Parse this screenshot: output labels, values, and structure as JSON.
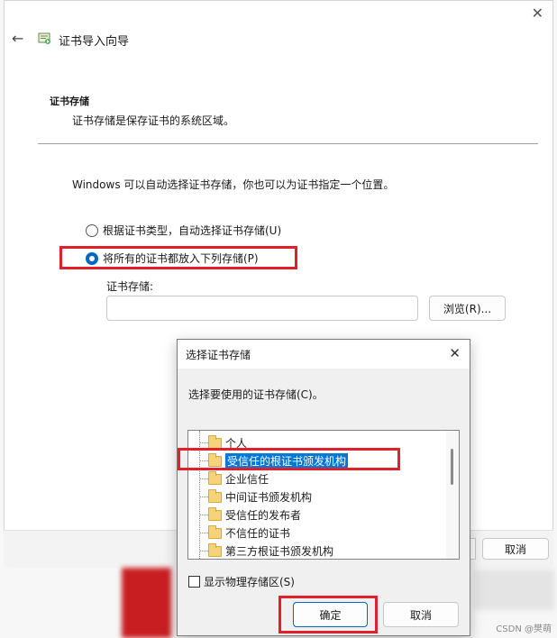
{
  "wizard": {
    "title": "证书导入向导",
    "close": "✕",
    "back": "←",
    "section_title": "证书存储",
    "section_desc": "证书存储是保存证书的系统区域。",
    "intro": "Windows 可以自动选择证书存储，你也可以为证书指定一个位置。",
    "radio_auto": "根据证书类型，自动选择证书存储(U)",
    "radio_manual": "将所有的证书都放入下列存储(P)",
    "store_label": "证书存储:",
    "store_value": "",
    "browse_button": "浏览(R)...",
    "cancel_button": "取消",
    "selected_option": "manual"
  },
  "dialog": {
    "title": "选择证书存储",
    "close": "✕",
    "instruction": "选择要使用的证书存储(C)。",
    "stores": [
      "个人",
      "受信任的根证书颁发机构",
      "企业信任",
      "中间证书颁发机构",
      "受信任的发布者",
      "不信任的证书",
      "第三方根证书颁发机构"
    ],
    "selected_store": "受信任的根证书颁发机构",
    "show_physical": "显示物理存储区(S)",
    "show_physical_checked": false,
    "ok_button": "确定",
    "cancel_button": "取消"
  },
  "watermark": "CSDN @樊萌",
  "colors": {
    "accent": "#0067c0",
    "selection": "#0078d7",
    "annotation_red": "#e0202a",
    "folder": "#f5d37a"
  }
}
